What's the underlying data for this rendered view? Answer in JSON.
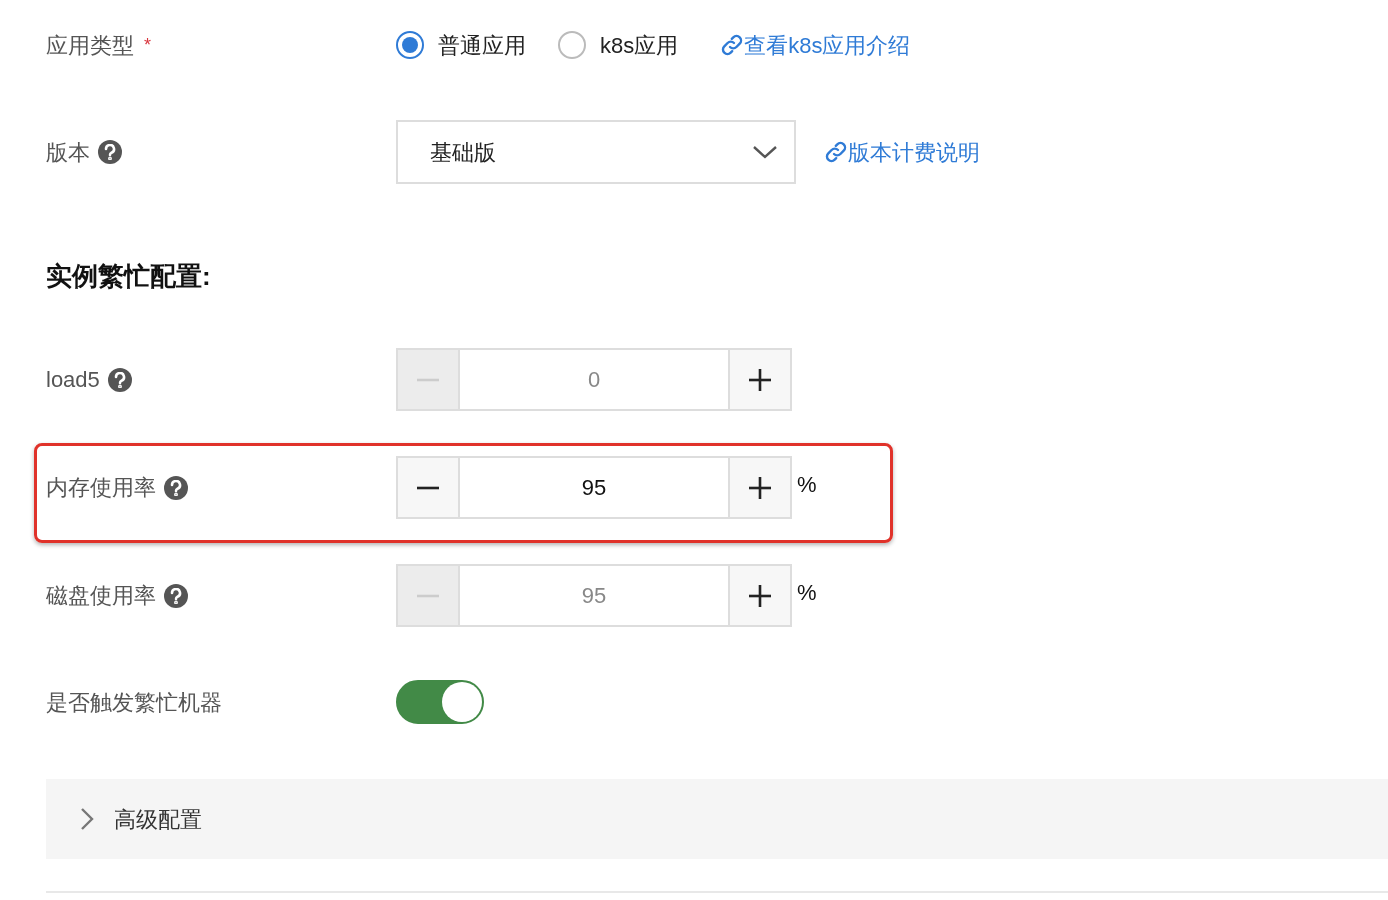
{
  "app_type": {
    "label": "应用类型",
    "required_mark": "*",
    "options": [
      {
        "label": "普通应用",
        "selected": true
      },
      {
        "label": "k8s应用",
        "selected": false
      }
    ],
    "link": "查看k8s应用介绍"
  },
  "version": {
    "label": "版本",
    "value": "基础版",
    "link": "版本计费说明"
  },
  "section_title": "实例繁忙配置:",
  "steppers": [
    {
      "label": "load5",
      "value": "0",
      "minus_disabled": true,
      "highlighted": false
    },
    {
      "label": "内存使用率",
      "value": "95",
      "minus_disabled": false,
      "unit": "%",
      "highlighted": true
    },
    {
      "label": "磁盘使用率",
      "value": "95",
      "minus_disabled": true,
      "unit": "%",
      "highlighted": false
    }
  ],
  "trigger": {
    "label": "是否触发繁忙机器",
    "on": true
  },
  "advanced": {
    "label": "高级配置",
    "expanded": false
  }
}
